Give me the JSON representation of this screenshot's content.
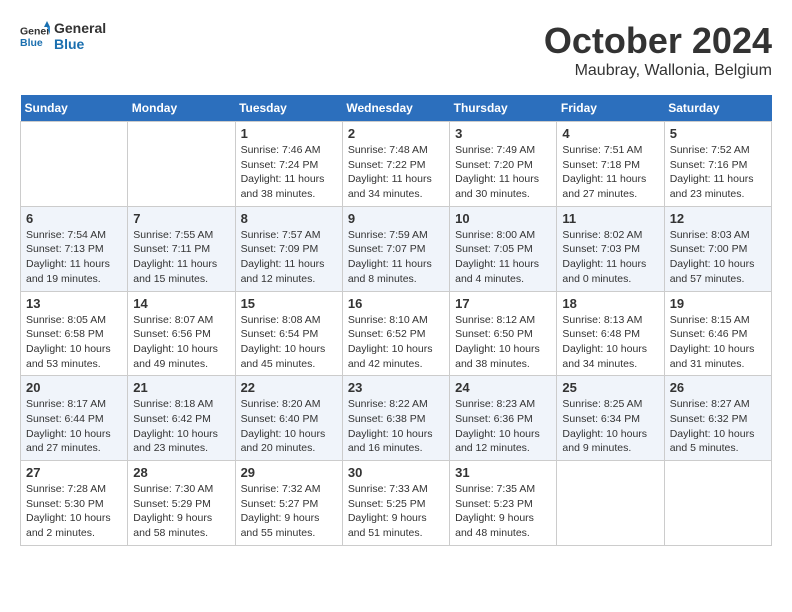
{
  "logo": {
    "line1": "General",
    "line2": "Blue"
  },
  "title": "October 2024",
  "location": "Maubray, Wallonia, Belgium",
  "days_of_week": [
    "Sunday",
    "Monday",
    "Tuesday",
    "Wednesday",
    "Thursday",
    "Friday",
    "Saturday"
  ],
  "weeks": [
    [
      {
        "day": "",
        "info": ""
      },
      {
        "day": "",
        "info": ""
      },
      {
        "day": "1",
        "info": "Sunrise: 7:46 AM\nSunset: 7:24 PM\nDaylight: 11 hours\nand 38 minutes."
      },
      {
        "day": "2",
        "info": "Sunrise: 7:48 AM\nSunset: 7:22 PM\nDaylight: 11 hours\nand 34 minutes."
      },
      {
        "day": "3",
        "info": "Sunrise: 7:49 AM\nSunset: 7:20 PM\nDaylight: 11 hours\nand 30 minutes."
      },
      {
        "day": "4",
        "info": "Sunrise: 7:51 AM\nSunset: 7:18 PM\nDaylight: 11 hours\nand 27 minutes."
      },
      {
        "day": "5",
        "info": "Sunrise: 7:52 AM\nSunset: 7:16 PM\nDaylight: 11 hours\nand 23 minutes."
      }
    ],
    [
      {
        "day": "6",
        "info": "Sunrise: 7:54 AM\nSunset: 7:13 PM\nDaylight: 11 hours\nand 19 minutes."
      },
      {
        "day": "7",
        "info": "Sunrise: 7:55 AM\nSunset: 7:11 PM\nDaylight: 11 hours\nand 15 minutes."
      },
      {
        "day": "8",
        "info": "Sunrise: 7:57 AM\nSunset: 7:09 PM\nDaylight: 11 hours\nand 12 minutes."
      },
      {
        "day": "9",
        "info": "Sunrise: 7:59 AM\nSunset: 7:07 PM\nDaylight: 11 hours\nand 8 minutes."
      },
      {
        "day": "10",
        "info": "Sunrise: 8:00 AM\nSunset: 7:05 PM\nDaylight: 11 hours\nand 4 minutes."
      },
      {
        "day": "11",
        "info": "Sunrise: 8:02 AM\nSunset: 7:03 PM\nDaylight: 11 hours\nand 0 minutes."
      },
      {
        "day": "12",
        "info": "Sunrise: 8:03 AM\nSunset: 7:00 PM\nDaylight: 10 hours\nand 57 minutes."
      }
    ],
    [
      {
        "day": "13",
        "info": "Sunrise: 8:05 AM\nSunset: 6:58 PM\nDaylight: 10 hours\nand 53 minutes."
      },
      {
        "day": "14",
        "info": "Sunrise: 8:07 AM\nSunset: 6:56 PM\nDaylight: 10 hours\nand 49 minutes."
      },
      {
        "day": "15",
        "info": "Sunrise: 8:08 AM\nSunset: 6:54 PM\nDaylight: 10 hours\nand 45 minutes."
      },
      {
        "day": "16",
        "info": "Sunrise: 8:10 AM\nSunset: 6:52 PM\nDaylight: 10 hours\nand 42 minutes."
      },
      {
        "day": "17",
        "info": "Sunrise: 8:12 AM\nSunset: 6:50 PM\nDaylight: 10 hours\nand 38 minutes."
      },
      {
        "day": "18",
        "info": "Sunrise: 8:13 AM\nSunset: 6:48 PM\nDaylight: 10 hours\nand 34 minutes."
      },
      {
        "day": "19",
        "info": "Sunrise: 8:15 AM\nSunset: 6:46 PM\nDaylight: 10 hours\nand 31 minutes."
      }
    ],
    [
      {
        "day": "20",
        "info": "Sunrise: 8:17 AM\nSunset: 6:44 PM\nDaylight: 10 hours\nand 27 minutes."
      },
      {
        "day": "21",
        "info": "Sunrise: 8:18 AM\nSunset: 6:42 PM\nDaylight: 10 hours\nand 23 minutes."
      },
      {
        "day": "22",
        "info": "Sunrise: 8:20 AM\nSunset: 6:40 PM\nDaylight: 10 hours\nand 20 minutes."
      },
      {
        "day": "23",
        "info": "Sunrise: 8:22 AM\nSunset: 6:38 PM\nDaylight: 10 hours\nand 16 minutes."
      },
      {
        "day": "24",
        "info": "Sunrise: 8:23 AM\nSunset: 6:36 PM\nDaylight: 10 hours\nand 12 minutes."
      },
      {
        "day": "25",
        "info": "Sunrise: 8:25 AM\nSunset: 6:34 PM\nDaylight: 10 hours\nand 9 minutes."
      },
      {
        "day": "26",
        "info": "Sunrise: 8:27 AM\nSunset: 6:32 PM\nDaylight: 10 hours\nand 5 minutes."
      }
    ],
    [
      {
        "day": "27",
        "info": "Sunrise: 7:28 AM\nSunset: 5:30 PM\nDaylight: 10 hours\nand 2 minutes."
      },
      {
        "day": "28",
        "info": "Sunrise: 7:30 AM\nSunset: 5:29 PM\nDaylight: 9 hours\nand 58 minutes."
      },
      {
        "day": "29",
        "info": "Sunrise: 7:32 AM\nSunset: 5:27 PM\nDaylight: 9 hours\nand 55 minutes."
      },
      {
        "day": "30",
        "info": "Sunrise: 7:33 AM\nSunset: 5:25 PM\nDaylight: 9 hours\nand 51 minutes."
      },
      {
        "day": "31",
        "info": "Sunrise: 7:35 AM\nSunset: 5:23 PM\nDaylight: 9 hours\nand 48 minutes."
      },
      {
        "day": "",
        "info": ""
      },
      {
        "day": "",
        "info": ""
      }
    ]
  ]
}
